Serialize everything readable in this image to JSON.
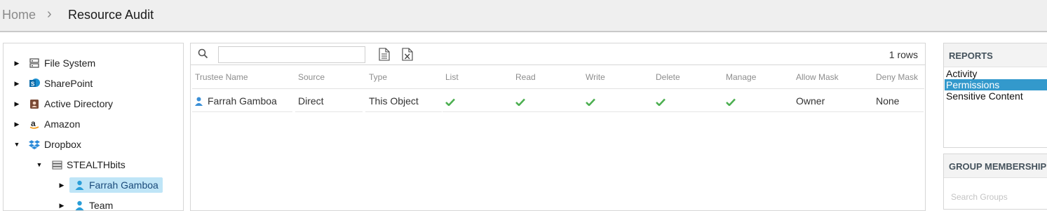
{
  "breadcrumb": {
    "home": "Home",
    "current": "Resource Audit"
  },
  "tree": {
    "items": [
      {
        "label": "File System",
        "icon": "server-icon"
      },
      {
        "label": "SharePoint",
        "icon": "sharepoint-icon"
      },
      {
        "label": "Active Directory",
        "icon": "active-directory-icon"
      },
      {
        "label": "Amazon",
        "icon": "amazon-icon"
      },
      {
        "label": "Dropbox",
        "icon": "dropbox-icon"
      },
      {
        "label": "STEALTHbits",
        "icon": "list-icon"
      },
      {
        "label": "Farrah Gamboa",
        "icon": "user-icon"
      },
      {
        "label": "Team",
        "icon": "user-icon"
      }
    ]
  },
  "grid": {
    "search_value": "",
    "row_count": "1 rows",
    "columns": [
      "Trustee Name",
      "Source",
      "Type",
      "List",
      "Read",
      "Write",
      "Delete",
      "Manage",
      "Allow Mask",
      "Deny Mask"
    ],
    "rows": [
      {
        "trustee": "Farrah Gamboa",
        "source": "Direct",
        "type": "This Object",
        "list": true,
        "read": true,
        "write": true,
        "delete": true,
        "manage": true,
        "allow_mask": "Owner",
        "deny_mask": "None"
      }
    ]
  },
  "reports": {
    "title": "REPORTS",
    "items": [
      "Activity",
      "Permissions",
      "Sensitive Content"
    ],
    "selected": "Permissions"
  },
  "group_membership": {
    "title": "GROUP MEMBERSHIP",
    "search_placeholder": "Search Groups"
  },
  "colors": {
    "accent": "#3399cc",
    "check": "#4caf50",
    "user_icon": "#3a8fd6",
    "selected_tree": "#bfe5f7"
  }
}
